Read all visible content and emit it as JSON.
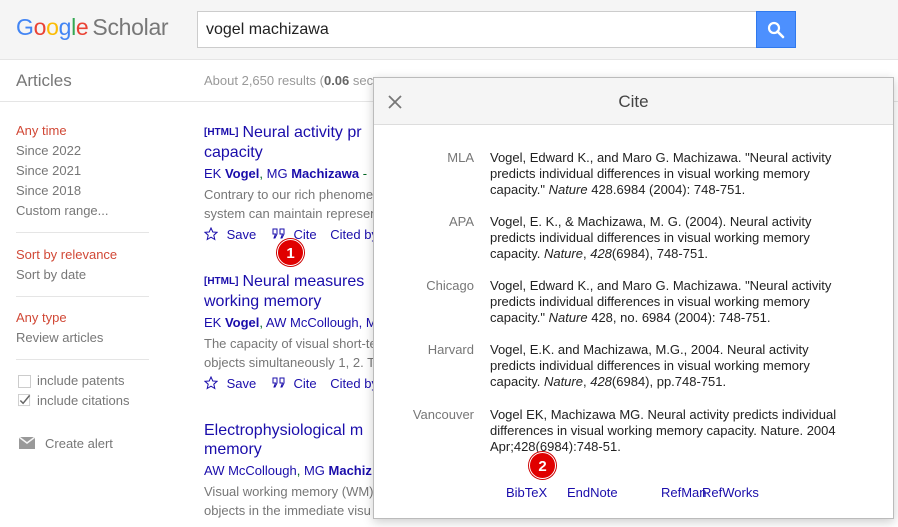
{
  "logo": {
    "g1": "G",
    "g2": "o",
    "g3": "o",
    "g4": "g",
    "g5": "l",
    "g6": "e",
    "scholar": "Scholar"
  },
  "search": {
    "query": "vogel machizawa"
  },
  "subbar": {
    "section": "Articles",
    "results_prefix": "About 2,650 results (",
    "results_time": "0.06",
    "results_suffix": " sec"
  },
  "sidebar": {
    "time": [
      "Any time",
      "Since 2022",
      "Since 2021",
      "Since 2018",
      "Custom range..."
    ],
    "sort": [
      "Sort by relevance",
      "Sort by date"
    ],
    "type": [
      "Any type",
      "Review articles"
    ],
    "include_patents": "include patents",
    "include_citations": "include citations",
    "create_alert": "Create alert"
  },
  "results": [
    {
      "tag": "[HTML]",
      "title_line1": "Neural activity pr",
      "title_line2": "capacity",
      "author1_init": "EK ",
      "author1_name": "Vogel",
      "sep": ", ",
      "author2_init": "MG ",
      "author2_name": "Machizawa",
      "authors_rest": " - ",
      "snippet_line1": "Contrary to our rich phenome",
      "snippet_line2": "system can maintain represen",
      "save": "Save",
      "cite": "Cite",
      "cited": "Cited by"
    },
    {
      "tag": "[HTML]",
      "title_line1": "Neural measures",
      "title_line2": "working memory",
      "author1_init": "EK ",
      "author1_name": "Vogel",
      "sep": ", ",
      "author2_full": "AW McCollough",
      "authors_rest": ", M",
      "snippet_line1": "The capacity of visual short-te",
      "snippet_line2": "objects simultaneously 1, 2. T",
      "save": "Save",
      "cite": "Cite",
      "cited": "Cited by"
    },
    {
      "title_line1": "Electrophysiological m",
      "title_line2": "memory",
      "author1_full": "AW McCollough",
      "sep": ", ",
      "author2_init": "MG ",
      "author2_name": "Machiz",
      "snippet_line1": "Visual working memory (WM)",
      "snippet_line2": "objects in the immediate visu"
    }
  ],
  "dialog": {
    "title": "Cite",
    "citations": [
      {
        "label": "MLA",
        "l1": "Vogel, Edward K., and Maro G. Machizawa. \"Neural activity",
        "l2": "predicts individual differences in visual working memory",
        "l3a": "capacity.\" ",
        "l3i": "Nature",
        "l3b": " 428.6984 (2004): 748-751."
      },
      {
        "label": "APA",
        "l1": "Vogel, E. K., & Machizawa, M. G. (2004). Neural activity",
        "l2": "predicts individual differences in visual working memory",
        "l3a": "capacity. ",
        "l3i": "Nature",
        "l3b": ", ",
        "l3i2": "428",
        "l3c": "(6984), 748-751."
      },
      {
        "label": "Chicago",
        "l1": "Vogel, Edward K., and Maro G. Machizawa. \"Neural activity",
        "l2": "predicts individual differences in visual working memory",
        "l3a": "capacity.\" ",
        "l3i": "Nature",
        "l3b": " 428, no. 6984 (2004): 748-751."
      },
      {
        "label": "Harvard",
        "l1": "Vogel, E.K. and Machizawa, M.G., 2004. Neural activity",
        "l2": "predicts individual differences in visual working memory",
        "l3a": "capacity. ",
        "l3i": "Nature",
        "l3b": ", ",
        "l3i2": "428",
        "l3c": "(6984), pp.748-751."
      },
      {
        "label": "Vancouver",
        "l1": "Vogel EK, Machizawa MG. Neural activity predicts individual",
        "l2": "differences in visual working memory capacity. Nature. 2004",
        "l3a": "Apr;428(6984):748-51."
      }
    ],
    "links": [
      "BibTeX",
      "EndNote",
      "RefMan",
      "RefWorks"
    ]
  },
  "markers": [
    "1",
    "2"
  ]
}
